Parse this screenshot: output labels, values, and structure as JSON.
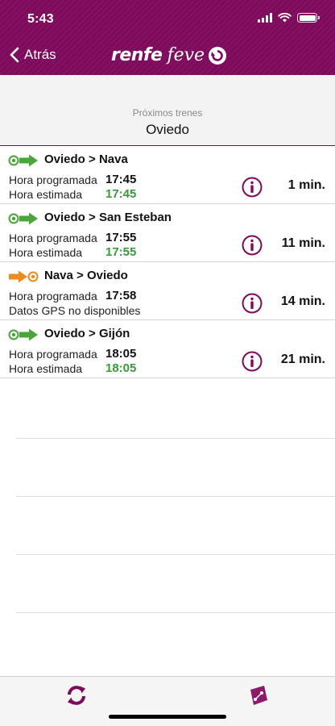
{
  "status_bar": {
    "time": "5:43"
  },
  "header": {
    "back_label": "Atrás",
    "logo_renfe": "renfe",
    "logo_feve": "feve",
    "brand_color": "#7e0a5c"
  },
  "subheader": {
    "label": "Próximos trenes",
    "station": "Oviedo"
  },
  "trains": [
    {
      "icon": "green-arrow-icon",
      "route": "Oviedo > Nava",
      "line1_label": "Hora programada",
      "line2_label": "Hora estimada",
      "scheduled": "17:45",
      "estimated": "17:45",
      "minutes": "1 min."
    },
    {
      "icon": "green-arrow-icon",
      "route": "Oviedo > San Esteban",
      "line1_label": "Hora programada",
      "line2_label": "Hora estimada",
      "scheduled": "17:55",
      "estimated": "17:55",
      "minutes": "11 min."
    },
    {
      "icon": "orange-arrow-icon",
      "route": "Nava > Oviedo",
      "line1_label": "Hora programada",
      "line2_label": "Datos GPS no disponibles",
      "scheduled": "17:58",
      "estimated": "",
      "minutes": "14 min."
    },
    {
      "icon": "green-arrow-icon",
      "route": "Oviedo > Gijón",
      "line1_label": "Hora programada",
      "line2_label": "Hora estimada",
      "scheduled": "18:05",
      "estimated": "18:05",
      "minutes": "21 min."
    }
  ],
  "colors": {
    "estimated_time": "#3a9a3a",
    "info_icon": "#7e0a5c",
    "route_green": "#4aa63a",
    "route_orange": "#f08a1e"
  }
}
